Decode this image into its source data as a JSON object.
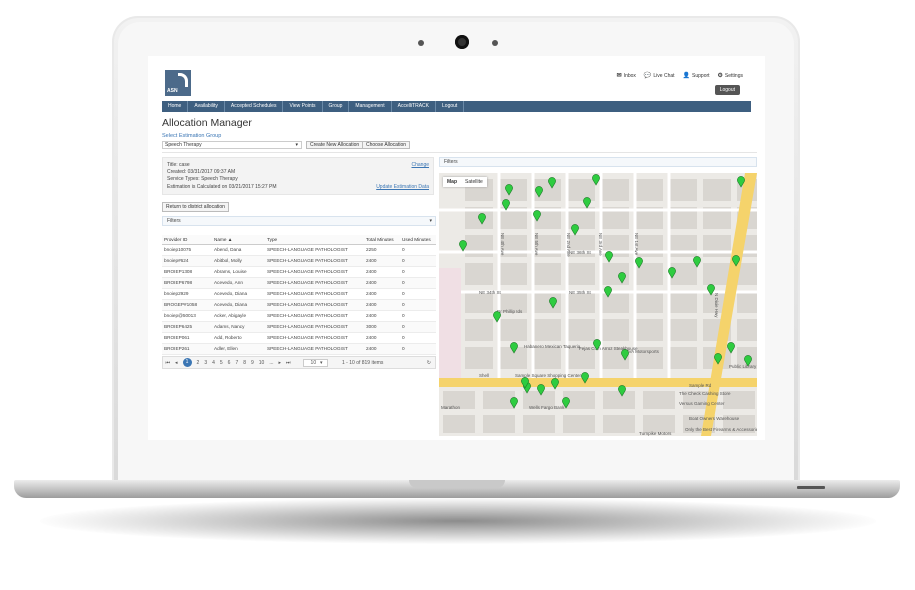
{
  "brand": {
    "logo_text": "ASN"
  },
  "header": {
    "links": [
      {
        "icon": "envelope-icon",
        "label": "Inbox"
      },
      {
        "icon": "chat-icon",
        "label": "Live Chat"
      },
      {
        "icon": "person-icon",
        "label": "Support"
      },
      {
        "icon": "gear-icon",
        "label": "Settings"
      }
    ],
    "logout_label": "Logout"
  },
  "nav": [
    "Home",
    "Availability",
    "Accepted Schedules",
    "View Points",
    "Group",
    "Management",
    "AccelliTRACK",
    "Logout"
  ],
  "page": {
    "title": "Allocation Manager",
    "select_group_label": "Select Estimation Group",
    "group_value": "Speech Therapy",
    "create_button": "Create New Allocation",
    "choose_button": "Choose Allocation"
  },
  "info": {
    "title": "Title: case",
    "created": "Created: 03/31/2017 09:37 AM",
    "service": "Service Types: Speech Therapy",
    "estimation": "Estimation is Calculated on 03/21/2017 15:27 PM",
    "change_link": "Change",
    "update_link": "Update Estimation Data"
  },
  "return_button": "Return to district allocation",
  "filters_label": "Filters",
  "table": {
    "headers": [
      "Provider ID",
      "Name ▲",
      "Type",
      "Total Minutes",
      "Used Minutes"
    ],
    "rows": [
      [
        "bnoiep10075",
        "Abend, Dana",
        "SPEECH-LANGUAGE PATHOLOGIST",
        "2250",
        "0"
      ],
      [
        "bnoiep#624",
        "Abitbol, Molly",
        "SPEECH-LANGUAGE PATHOLOGIST",
        "2400",
        "0"
      ],
      [
        "BROIEP1308",
        "Abrams, Louise",
        "SPEECH-LANGUAGE PATHOLOGIST",
        "2400",
        "0"
      ],
      [
        "BROIEP6798",
        "Acevedo, Ann",
        "SPEECH-LANGUAGE PATHOLOGIST",
        "2400",
        "0"
      ],
      [
        "bnoiep2929",
        "Acevedo, Diana",
        "SPEECH-LANGUAGE PATHOLOGIST",
        "2400",
        "0"
      ],
      [
        "BROGEP#1058",
        "Acevedo, Diana",
        "SPEECH-LANGUAGE PATHOLOGIST",
        "2400",
        "0"
      ],
      [
        "bnoiep@50013",
        "Acker, Abigayle",
        "SPEECH-LANGUAGE PATHOLOGIST",
        "2400",
        "0"
      ],
      [
        "BROIEP6425",
        "Adams, Nancy",
        "SPEECH-LANGUAGE PATHOLOGIST",
        "3000",
        "0"
      ],
      [
        "BROIEP061",
        "Add, Roberto",
        "SPEECH-LANGUAGE PATHOLOGIST",
        "2400",
        "0"
      ],
      [
        "BROIEP261",
        "Adler, Ellen",
        "SPEECH-LANGUAGE PATHOLOGIST",
        "2400",
        "0"
      ]
    ]
  },
  "pager": {
    "pages": [
      "1",
      "2",
      "3",
      "4",
      "5",
      "6",
      "7",
      "8",
      "9",
      "10",
      "..."
    ],
    "page_size": "10",
    "summary": "1 - 10 of 819 items"
  },
  "map": {
    "tabs": [
      "Map",
      "Satellite"
    ],
    "roads": [
      "NE 36th St",
      "NE 35th St",
      "NE 34th St",
      "Sample Rd",
      "N Dixie Hwy",
      "NE 5th Ave",
      "NE 4th Ave",
      "NE 2nd Ave",
      "NE 3rd Ave",
      "NE 1st Ave"
    ],
    "places": [
      "Dr Phillip Ids",
      "Habanero Mexican Taqueria",
      "Fejas Com Arroz Steakhouse",
      "Sample Square Shopping Center",
      "RIVA Motorsports",
      "Shell",
      "Wells Fargo Bank",
      "The Check Cashing Store",
      "Versus Gaming Center",
      "Boat Owners Warehouse",
      "Only the Best Firearms & Accessories",
      "Turnpike Motors",
      "Public Library",
      "Marathon"
    ],
    "pin_color": "#2ecc40"
  },
  "colors": {
    "nav": "#3e5f80",
    "link": "#3b76b4"
  }
}
